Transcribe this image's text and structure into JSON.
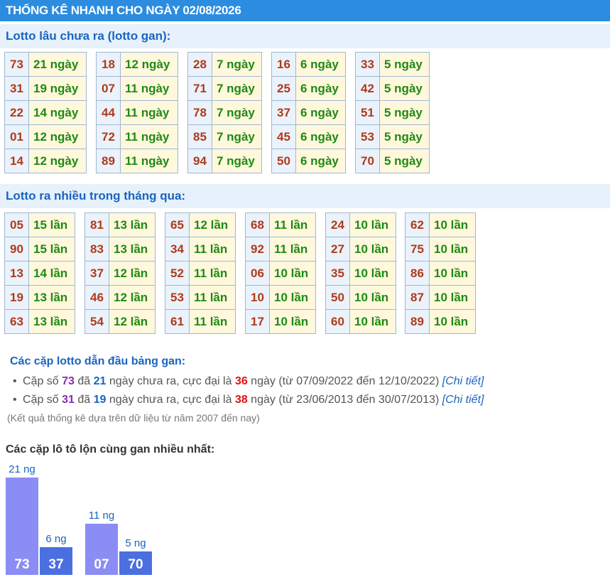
{
  "header": {
    "title": "THỐNG KÊ NHANH CHO NGÀY 02/08/2026"
  },
  "gan": {
    "title": "Lotto lâu chưa ra (lotto gan):",
    "groups": [
      [
        {
          "n": "73",
          "v": "21 ngày"
        },
        {
          "n": "31",
          "v": "19 ngày"
        },
        {
          "n": "22",
          "v": "14 ngày"
        },
        {
          "n": "01",
          "v": "12 ngày"
        },
        {
          "n": "14",
          "v": "12 ngày"
        }
      ],
      [
        {
          "n": "18",
          "v": "12 ngày"
        },
        {
          "n": "07",
          "v": "11 ngày"
        },
        {
          "n": "44",
          "v": "11 ngày"
        },
        {
          "n": "72",
          "v": "11 ngày"
        },
        {
          "n": "89",
          "v": "11 ngày"
        }
      ],
      [
        {
          "n": "28",
          "v": "7 ngày"
        },
        {
          "n": "71",
          "v": "7 ngày"
        },
        {
          "n": "78",
          "v": "7 ngày"
        },
        {
          "n": "85",
          "v": "7 ngày"
        },
        {
          "n": "94",
          "v": "7 ngày"
        }
      ],
      [
        {
          "n": "16",
          "v": "6 ngày"
        },
        {
          "n": "25",
          "v": "6 ngày"
        },
        {
          "n": "37",
          "v": "6 ngày"
        },
        {
          "n": "45",
          "v": "6 ngày"
        },
        {
          "n": "50",
          "v": "6 ngày"
        }
      ],
      [
        {
          "n": "33",
          "v": "5 ngày"
        },
        {
          "n": "42",
          "v": "5 ngày"
        },
        {
          "n": "51",
          "v": "5 ngày"
        },
        {
          "n": "53",
          "v": "5 ngày"
        },
        {
          "n": "70",
          "v": "5 ngày"
        }
      ]
    ]
  },
  "frequent": {
    "title": "Lotto ra nhiều trong tháng qua:",
    "groups": [
      [
        {
          "n": "05",
          "v": "15 lần"
        },
        {
          "n": "90",
          "v": "15 lần"
        },
        {
          "n": "13",
          "v": "14 lần"
        },
        {
          "n": "19",
          "v": "13 lần"
        },
        {
          "n": "63",
          "v": "13 lần"
        }
      ],
      [
        {
          "n": "81",
          "v": "13 lần"
        },
        {
          "n": "83",
          "v": "13 lần"
        },
        {
          "n": "37",
          "v": "12 lần"
        },
        {
          "n": "46",
          "v": "12 lần"
        },
        {
          "n": "54",
          "v": "12 lần"
        }
      ],
      [
        {
          "n": "65",
          "v": "12 lần"
        },
        {
          "n": "34",
          "v": "11 lần"
        },
        {
          "n": "52",
          "v": "11 lần"
        },
        {
          "n": "53",
          "v": "11 lần"
        },
        {
          "n": "61",
          "v": "11 lần"
        }
      ],
      [
        {
          "n": "68",
          "v": "11 lần"
        },
        {
          "n": "92",
          "v": "11 lần"
        },
        {
          "n": "06",
          "v": "10 lần"
        },
        {
          "n": "10",
          "v": "10 lần"
        },
        {
          "n": "17",
          "v": "10 lần"
        }
      ],
      [
        {
          "n": "24",
          "v": "10 lần"
        },
        {
          "n": "27",
          "v": "10 lần"
        },
        {
          "n": "35",
          "v": "10 lần"
        },
        {
          "n": "50",
          "v": "10 lần"
        },
        {
          "n": "60",
          "v": "10 lần"
        }
      ],
      [
        {
          "n": "62",
          "v": "10 lần"
        },
        {
          "n": "75",
          "v": "10 lần"
        },
        {
          "n": "86",
          "v": "10 lần"
        },
        {
          "n": "87",
          "v": "10 lần"
        },
        {
          "n": "89",
          "v": "10 lần"
        }
      ]
    ]
  },
  "pairs": {
    "title": "Các cặp lotto dẫn đầu bảng gan:",
    "items": [
      {
        "p1": "Cặp số ",
        "num": "73",
        "p2": " đã ",
        "days": "21",
        "p3": " ngày chưa ra, cực đại là ",
        "max": "36",
        "p4": " ngày (từ 07/09/2022 đến 12/10/2022) ",
        "link": "[Chi tiết]"
      },
      {
        "p1": "Cặp số ",
        "num": "31",
        "p2": " đã ",
        "days": "19",
        "p3": " ngày chưa ra, cực đại là ",
        "max": "38",
        "p4": " ngày (từ 23/06/2013 đến 30/07/2013) ",
        "link": "[Chi tiết]"
      }
    ],
    "note": "(Kết quả thống kê dựa trên dữ liệu từ năm 2007 đến nay)"
  },
  "bars": {
    "title": "Các cặp lô tô lộn cùng gan nhiều nhất:",
    "colors": {
      "primary": "#8c8cf5",
      "secondary": "#4a6fe0"
    },
    "items": [
      {
        "num": "73",
        "days": 21,
        "label": "21 ng",
        "tone": "primary"
      },
      {
        "num": "37",
        "days": 6,
        "label": "6 ng",
        "tone": "secondary"
      },
      {
        "num": "07",
        "days": 11,
        "label": "11 ng",
        "tone": "primary"
      },
      {
        "num": "70",
        "days": 5,
        "label": "5 ng",
        "tone": "secondary"
      }
    ]
  }
}
